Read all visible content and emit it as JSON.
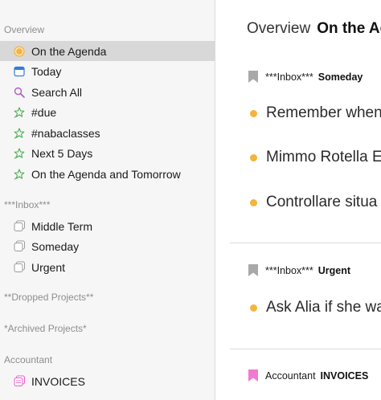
{
  "sidebar": {
    "section_overview": "Overview",
    "items_overview": [
      {
        "label": "On the Agenda",
        "icon": "agenda-sun-icon",
        "selected": true
      },
      {
        "label": "Today",
        "icon": "calendar-icon"
      },
      {
        "label": "Search All",
        "icon": "search-icon"
      },
      {
        "label": "#due",
        "icon": "star-pin-icon"
      },
      {
        "label": "#nabaclasses",
        "icon": "star-pin-icon"
      },
      {
        "label": "Next 5 Days",
        "icon": "star-pin-icon"
      },
      {
        "label": "On the Agenda and Tomorrow",
        "icon": "star-pin-icon"
      }
    ],
    "section_inbox": "***Inbox***",
    "items_inbox": [
      {
        "label": "Middle Term",
        "icon": "notebook-icon"
      },
      {
        "label": "Someday",
        "icon": "notebook-icon"
      },
      {
        "label": "Urgent",
        "icon": "notebook-icon"
      }
    ],
    "section_dropped": "**Dropped Projects**",
    "section_archived": "*Archived Projects*",
    "section_accountant": "Accountant",
    "items_accountant": [
      {
        "label": "INVOICES",
        "icon": "notebook-pink-icon"
      }
    ]
  },
  "main": {
    "title_crumb": "Overview",
    "title_strong": "On the Agenda",
    "groups": [
      {
        "inbox": "***Inbox***",
        "name": "Someday",
        "flag_color": "#a9a9a9",
        "tasks": [
          "Remember when",
          "Mimmo Rotella E",
          "Controllare situa"
        ]
      },
      {
        "inbox": "***Inbox***",
        "name": "Urgent",
        "flag_color": "#a9a9a9",
        "tasks": [
          "Ask Alia if she wa"
        ]
      },
      {
        "inbox": "Accountant",
        "name": "INVOICES",
        "flag_color": "#f07ad2",
        "tasks": []
      }
    ]
  },
  "colors": {
    "accent_dot": "#f5b43c",
    "selected_bg": "#d8d8d8",
    "star_icon": "#4caf50",
    "search_icon": "#b05cc8",
    "calendar_icon": "#2f7fd9",
    "invoices_icon": "#e85cc8"
  }
}
